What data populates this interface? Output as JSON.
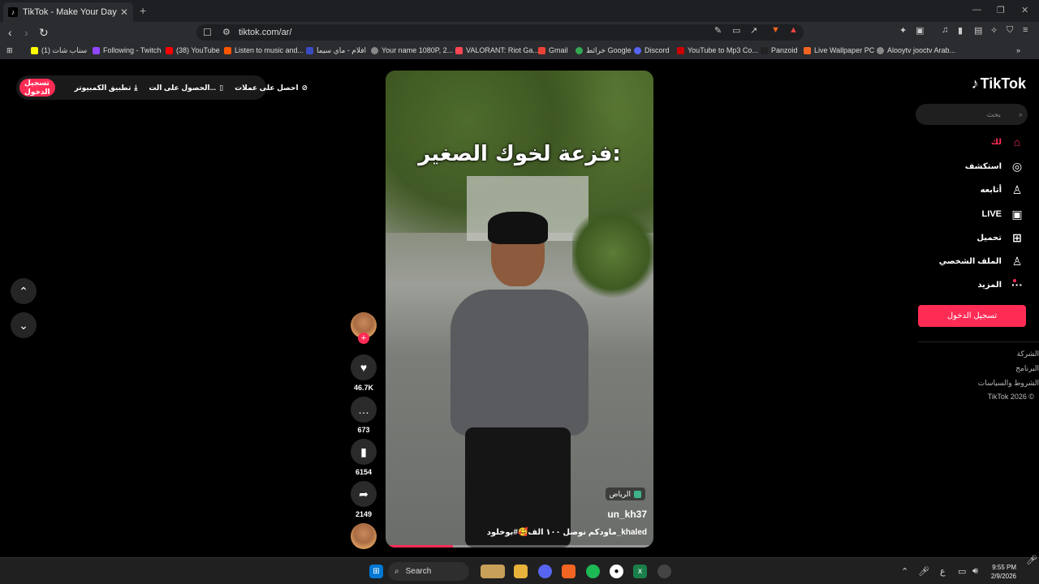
{
  "browser": {
    "tab_title": "TikTok - Make Your Day",
    "tab_close": "✕",
    "new_tab": "+",
    "url": "tiktok.com/ar/",
    "bookmarks": [
      "(1) سناب شات",
      "Following - Twitch",
      "(38) YouTube",
      "Listen to music and...",
      "افلام - ماي سيما",
      "Your name 1080P, 2...",
      "VALORANT: Riot Ga...",
      "Gmail",
      "خرائط Google",
      "Discord",
      "YouTube to Mp3 Co...",
      "Panzoid",
      "Live Wallpaper PC",
      "Alooytv jooctv Arab..."
    ]
  },
  "topbar": {
    "signin": "تسجيل الدخول",
    "desktop_app": "تطبيق الكمبيوتر",
    "get_app": "الحصول على الت...",
    "coins": "احصل على عملات"
  },
  "video": {
    "caption": "فزعة لخوك الصغير:",
    "location": "الرياض",
    "username": "un_kh37",
    "description": "ماودكم نوصل ١٠٠ الف🥰#بوخلود_khaled",
    "progress": 0.25
  },
  "actions": {
    "likes": "46.7K",
    "comments": "673",
    "saves": "6154",
    "shares": "2149",
    "follow_plus": "+"
  },
  "sidebar": {
    "logo": "TikTok",
    "search_placeholder": "بحث",
    "nav": {
      "home": "لك",
      "explore": "استكشف",
      "following": "أتابعه",
      "live": "LIVE",
      "upload": "تحميل",
      "profile": "الملف الشخصي",
      "more": "المزيد"
    },
    "signin_button": "تسجيل الدخول",
    "footer": [
      "الشركة",
      "البرنامج",
      "الشروط والسياسات",
      "TikTok 2026 ©"
    ]
  },
  "taskbar": {
    "search": "Search",
    "lang": "ع",
    "time": "9:55 PM",
    "date": "2/9/2026"
  },
  "colors": {
    "accent": "#fe2c55",
    "background": "#000000"
  }
}
